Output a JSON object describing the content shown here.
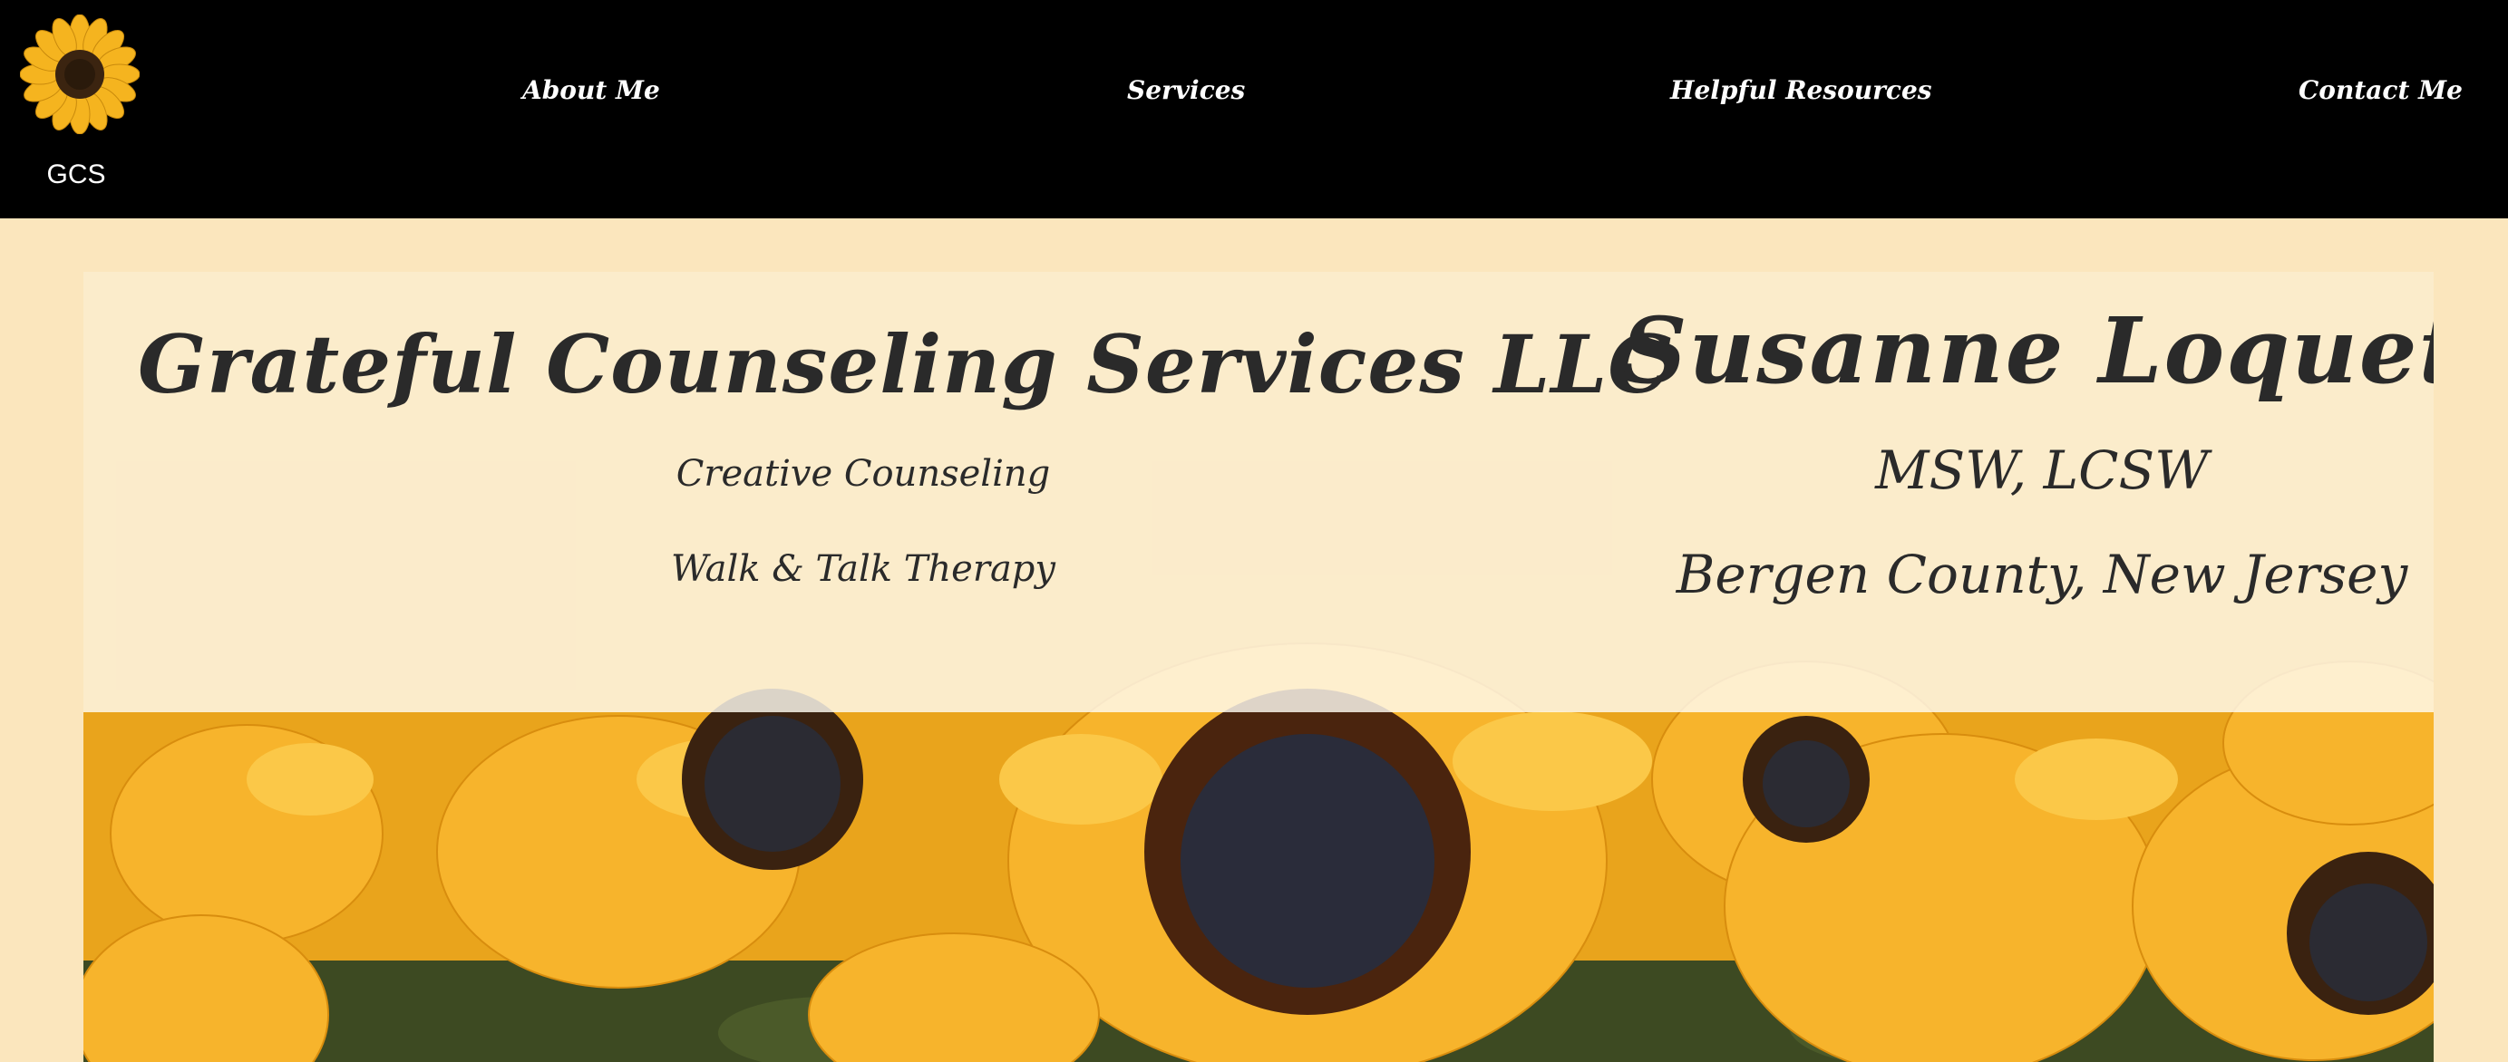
{
  "header": {
    "logo": {
      "icon": "sunflower-icon",
      "text": "GCS"
    },
    "nav": [
      {
        "label": "About Me"
      },
      {
        "label": "Services"
      },
      {
        "label": "Helpful Resources"
      },
      {
        "label": "Contact Me"
      }
    ]
  },
  "hero": {
    "image": "sunflowers-photo",
    "company_name": "Grateful Counseling Services LLC",
    "taglines": [
      "Creative Counseling",
      "Walk & Talk Therapy"
    ],
    "person_name": "Susanne Loquet",
    "credentials": "MSW, LCSW",
    "location": "Bergen County, New Jersey"
  },
  "colors": {
    "header_bg": "#000000",
    "page_bg": "#fbe6bd",
    "petal": "#f6b728",
    "text": "#2a2a2a"
  }
}
